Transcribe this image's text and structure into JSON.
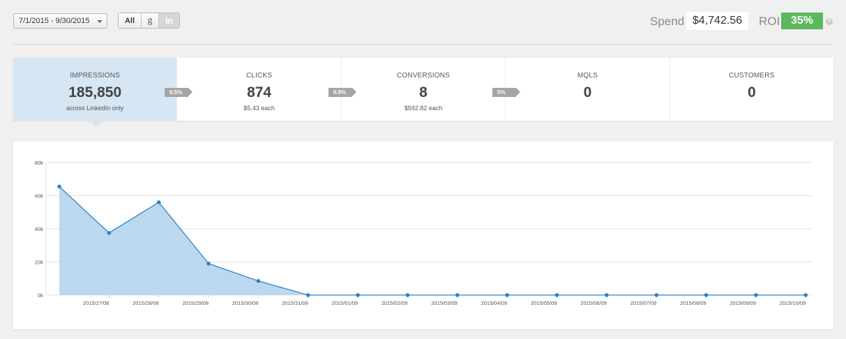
{
  "toolbar": {
    "date_range": "7/1/2015 - 9/30/2015",
    "filter_all": "All",
    "filter_google": "g",
    "filter_linkedin": "in"
  },
  "summary": {
    "spend_label": "Spend",
    "spend_value": "$4,742.56",
    "roi_label": "ROI",
    "roi_value": "35%",
    "help_icon": "?"
  },
  "metrics": [
    {
      "label": "IMPRESSIONS",
      "value": "185,850",
      "sub": "across LinkedIn only"
    },
    {
      "label": "CLICKS",
      "value": "874",
      "sub": "$5.43 each"
    },
    {
      "label": "CONVERSIONS",
      "value": "8",
      "sub": "$592.82 each"
    },
    {
      "label": "MQLS",
      "value": "0",
      "sub": ""
    },
    {
      "label": "CUSTOMERS",
      "value": "0",
      "sub": ""
    }
  ],
  "rates": [
    "0.5%",
    "0.9%",
    "0%"
  ],
  "colors": {
    "accent_fill": "#bcd8ee",
    "line": "#2b82c9",
    "roi_green": "#5cb85c",
    "active_metric": "#d6e6f3"
  },
  "chart_data": {
    "type": "area",
    "x": [
      "",
      "2015/27/08",
      "2015/28/08",
      "2015/29/08",
      "2015/30/08",
      "2015/31/08",
      "2015/01/09",
      "2015/02/09",
      "2015/03/09",
      "2015/04/09",
      "2015/05/09",
      "2015/06/09",
      "2015/07/09",
      "2015/08/09",
      "2015/09/09",
      "2015/10/09"
    ],
    "values": [
      65500,
      37500,
      56000,
      19000,
      8500,
      0,
      0,
      0,
      0,
      0,
      0,
      0,
      0,
      0,
      0,
      0
    ],
    "yticks": [
      "0k",
      "20k",
      "40k",
      "60k",
      "80k"
    ],
    "ylim": [
      0,
      80000
    ],
    "grid": true,
    "title": "",
    "xlabel": "",
    "ylabel": ""
  }
}
